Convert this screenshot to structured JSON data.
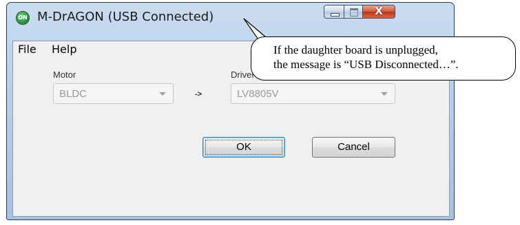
{
  "window": {
    "title": "M-DrAGON (USB Connected)",
    "icon": "on-semi-logo",
    "icon_text": "ON"
  },
  "title_buttons": {
    "minimize": "minimize-icon",
    "maximize": "maximize-icon",
    "close": "close-icon",
    "close_glyph": "X"
  },
  "menu": {
    "file": "File",
    "help": "Help"
  },
  "form": {
    "motor_label": "Motor",
    "motor_value": "BLDC",
    "arrow": "->",
    "driver_label": "Driver",
    "driver_value": "LV8805V"
  },
  "buttons": {
    "ok": "OK",
    "cancel": "Cancel"
  },
  "callout": {
    "line1": "If the daughter board is unplugged,",
    "line2": "the message is “USB Disconnected…”."
  },
  "colors": {
    "title_bar": "#b7cde8",
    "close_button": "#c0321a",
    "disabled_text": "#9a9a9a"
  }
}
